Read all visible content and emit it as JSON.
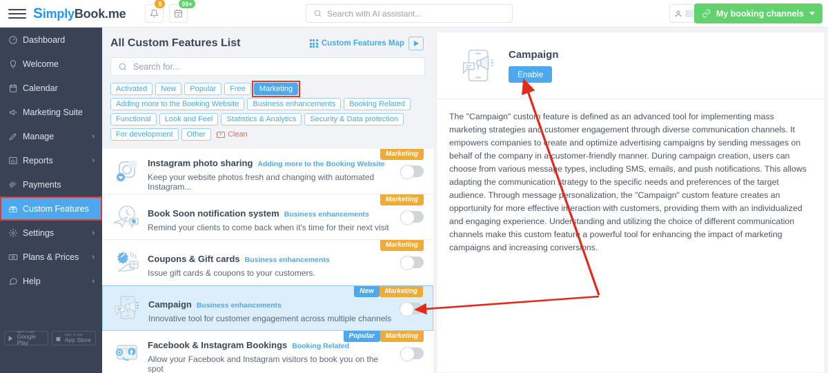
{
  "topbar": {
    "logo_s": "S",
    "logo_rest": "imply",
    "logo_book": "Book",
    "logo_me": ".me",
    "bell_badge": "5",
    "calendar_badge": "99+",
    "ai_search_placeholder": "Search with AI assistant...",
    "booking_channels_label": "My booking channels"
  },
  "sidebar": {
    "items": [
      {
        "label": "Dashboard",
        "icon": "dashboard-icon",
        "chevron": false
      },
      {
        "label": "Welcome",
        "icon": "bulb-icon",
        "chevron": false
      },
      {
        "label": "Calendar",
        "icon": "calendar-icon",
        "chevron": false
      },
      {
        "label": "Marketing Suite",
        "icon": "megaphone-icon",
        "chevron": false
      },
      {
        "label": "Manage",
        "icon": "pencil-icon",
        "chevron": true
      },
      {
        "label": "Reports",
        "icon": "chart-icon",
        "chevron": true
      },
      {
        "label": "Payments",
        "icon": "payments-icon",
        "chevron": false
      },
      {
        "label": "Custom Features",
        "icon": "gift-icon",
        "chevron": false,
        "active": true
      },
      {
        "label": "Settings",
        "icon": "gear-icon",
        "chevron": true
      },
      {
        "label": "Plans & Prices",
        "icon": "money-icon",
        "chevron": true
      },
      {
        "label": "Help",
        "icon": "chat-icon",
        "chevron": true
      }
    ],
    "store_badges": [
      {
        "top": "GET IT ON",
        "main": "Google Play",
        "icon": "google-play-icon"
      },
      {
        "top": "GET IT ON",
        "main": "App Store",
        "icon": "apple-icon"
      }
    ]
  },
  "list_panel": {
    "title": "All Custom Features List",
    "map_link": "Custom Features Map",
    "search_placeholder": "Search for...",
    "filters": [
      {
        "label": "Activated",
        "selected": false
      },
      {
        "label": "New",
        "selected": false
      },
      {
        "label": "Popular",
        "selected": false
      },
      {
        "label": "Free",
        "selected": false
      },
      {
        "label": "Marketing",
        "selected": true
      },
      {
        "label": "Adding more to the Booking Website",
        "selected": false
      },
      {
        "label": "Business enhancements",
        "selected": false
      },
      {
        "label": "Booking Related",
        "selected": false
      },
      {
        "label": "Functional",
        "selected": false
      },
      {
        "label": "Look and Feel",
        "selected": false
      },
      {
        "label": "Statistics & Analytics",
        "selected": false
      },
      {
        "label": "Security & Data protection",
        "selected": false
      },
      {
        "label": "For development",
        "selected": false
      },
      {
        "label": "Other",
        "selected": false
      }
    ],
    "clean_label": "Clean",
    "features": [
      {
        "name": "Instagram photo sharing",
        "category": "Adding more to the Booking Website",
        "description": "Keep your website photos fresh and changing with automated Instagram...",
        "tags": [
          "Marketing"
        ],
        "icon": "instagram-icon",
        "enabled": false,
        "highlighted": false
      },
      {
        "name": "Book Soon notification system",
        "category": "Business enhancements",
        "description": "Remind your clients to come back when it's time for their next visit",
        "tags": [
          "Marketing"
        ],
        "icon": "notification-icon",
        "enabled": false,
        "highlighted": false
      },
      {
        "name": "Coupons & Gift cards",
        "category": "Business enhancements",
        "description": "Issue gift cards & coupons to your customers.",
        "tags": [
          "Marketing"
        ],
        "icon": "coupon-icon",
        "enabled": false,
        "highlighted": false
      },
      {
        "name": "Campaign",
        "category": "Business enhancements",
        "description": "Innovative tool for customer engagement across multiple channels",
        "tags": [
          "New",
          "Marketing"
        ],
        "icon": "campaign-icon",
        "enabled": false,
        "highlighted": true
      },
      {
        "name": "Facebook & Instagram Bookings",
        "category": "Booking Related",
        "description": "Allow your Facebook and Instagram visitors to book you on the spot",
        "tags": [
          "Popular",
          "Marketing"
        ],
        "icon": "facebook-instagram-icon",
        "enabled": false,
        "highlighted": false
      }
    ]
  },
  "detail": {
    "title": "Campaign",
    "enable_label": "Enable",
    "description": "The \"Campaign\" custom feature is defined as an advanced tool for implementing mass marketing strategies and customer engagement through diverse communication channels. It empowers companies to create and optimize advertising campaigns by sending messages on behalf of the company in a customer-friendly manner. During campaign creation, users can choose from various message types, including SMS, emails, and push notifications. This allows adapting the communication strategy to the specific needs and preferences of the target audience. Through message personalization, the \"Campaign\" custom feature creates an opportunity for more effective interaction with customers, providing them with an individualized and engaging experience. Understanding and utilizing the choice of different communication channels make this custom feature a powerful tool for enhancing the impact of marketing campaigns and increasing conversions."
  },
  "colors": {
    "accent_blue": "#4ea8ed",
    "sidebar_bg": "#3a4356",
    "green": "#62d26f",
    "orange_tag": "#f0ab36",
    "annotation_red": "#e12a1c"
  }
}
